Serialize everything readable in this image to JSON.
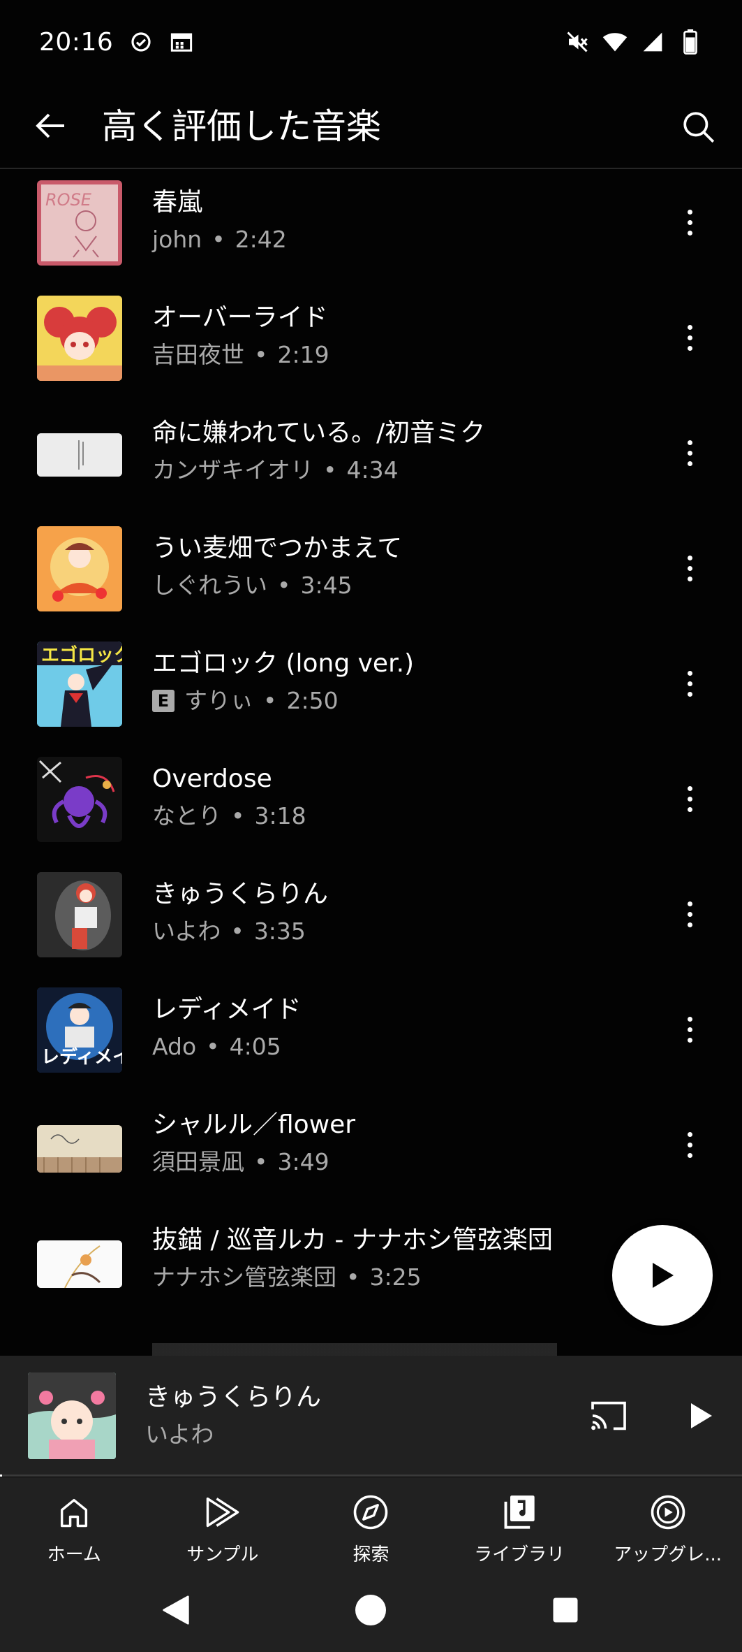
{
  "status_bar": {
    "time": "20:16"
  },
  "header": {
    "title": "高く評価した音楽"
  },
  "songs": [
    {
      "title": "春嵐",
      "artist": "john",
      "duration": "2:42",
      "explicit": false
    },
    {
      "title": "オーバーライド",
      "artist": "吉田夜世",
      "duration": "2:19",
      "explicit": false
    },
    {
      "title": "命に嫌われている。/初音ミク",
      "artist": "カンザキイオリ",
      "duration": "4:34",
      "explicit": false
    },
    {
      "title": "うい麦畑でつかまえて",
      "artist": "しぐれうい",
      "duration": "3:45",
      "explicit": false
    },
    {
      "title": "エゴロック (long ver.)",
      "artist": "すりぃ",
      "duration": "2:50",
      "explicit": true,
      "explicit_badge": "E"
    },
    {
      "title": "Overdose",
      "artist": "なとり",
      "duration": "3:18",
      "explicit": false
    },
    {
      "title": "きゅうくらりん",
      "artist": "いよわ",
      "duration": "3:35",
      "explicit": false
    },
    {
      "title": "レディメイド",
      "artist": "Ado",
      "duration": "4:05",
      "explicit": false
    },
    {
      "title": "シャルル／flower",
      "artist": "須田景凪",
      "duration": "3:49",
      "explicit": false
    },
    {
      "title": "抜錨 / 巡音ルカ - ナナホシ管弦楽団",
      "artist": "ナナホシ管弦楽団",
      "duration": "3:25",
      "explicit": false
    }
  ],
  "separator": "•",
  "mini_player": {
    "title": "きゅうくらりん",
    "artist": "いよわ",
    "progress": 0.003
  },
  "bottom_nav": [
    {
      "label": "ホーム",
      "icon": "home-icon"
    },
    {
      "label": "サンプル",
      "icon": "samples-icon"
    },
    {
      "label": "探索",
      "icon": "explore-icon"
    },
    {
      "label": "ライブラリ",
      "icon": "library-icon"
    },
    {
      "label": "アップグレ...",
      "icon": "upgrade-icon"
    }
  ]
}
